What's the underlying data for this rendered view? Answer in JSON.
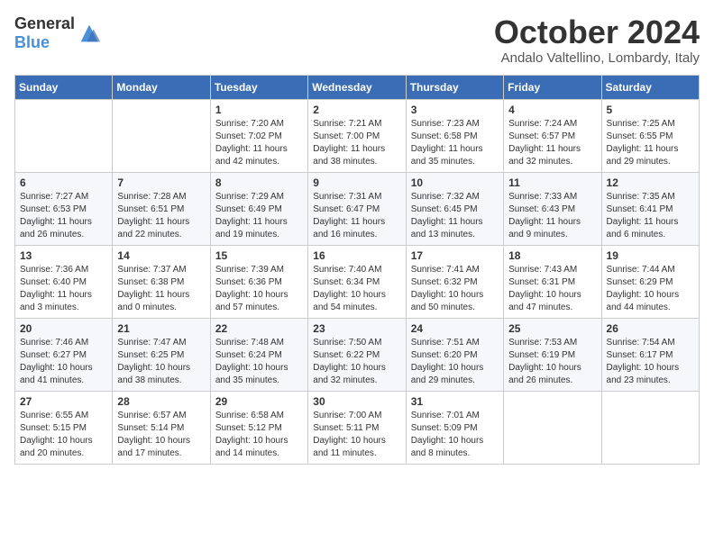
{
  "header": {
    "logo_general": "General",
    "logo_blue": "Blue",
    "month": "October 2024",
    "location": "Andalo Valtellino, Lombardy, Italy"
  },
  "weekdays": [
    "Sunday",
    "Monday",
    "Tuesday",
    "Wednesday",
    "Thursday",
    "Friday",
    "Saturday"
  ],
  "weeks": [
    [
      {
        "day": "",
        "info": ""
      },
      {
        "day": "",
        "info": ""
      },
      {
        "day": "1",
        "info": "Sunrise: 7:20 AM\nSunset: 7:02 PM\nDaylight: 11 hours and 42 minutes."
      },
      {
        "day": "2",
        "info": "Sunrise: 7:21 AM\nSunset: 7:00 PM\nDaylight: 11 hours and 38 minutes."
      },
      {
        "day": "3",
        "info": "Sunrise: 7:23 AM\nSunset: 6:58 PM\nDaylight: 11 hours and 35 minutes."
      },
      {
        "day": "4",
        "info": "Sunrise: 7:24 AM\nSunset: 6:57 PM\nDaylight: 11 hours and 32 minutes."
      },
      {
        "day": "5",
        "info": "Sunrise: 7:25 AM\nSunset: 6:55 PM\nDaylight: 11 hours and 29 minutes."
      }
    ],
    [
      {
        "day": "6",
        "info": "Sunrise: 7:27 AM\nSunset: 6:53 PM\nDaylight: 11 hours and 26 minutes."
      },
      {
        "day": "7",
        "info": "Sunrise: 7:28 AM\nSunset: 6:51 PM\nDaylight: 11 hours and 22 minutes."
      },
      {
        "day": "8",
        "info": "Sunrise: 7:29 AM\nSunset: 6:49 PM\nDaylight: 11 hours and 19 minutes."
      },
      {
        "day": "9",
        "info": "Sunrise: 7:31 AM\nSunset: 6:47 PM\nDaylight: 11 hours and 16 minutes."
      },
      {
        "day": "10",
        "info": "Sunrise: 7:32 AM\nSunset: 6:45 PM\nDaylight: 11 hours and 13 minutes."
      },
      {
        "day": "11",
        "info": "Sunrise: 7:33 AM\nSunset: 6:43 PM\nDaylight: 11 hours and 9 minutes."
      },
      {
        "day": "12",
        "info": "Sunrise: 7:35 AM\nSunset: 6:41 PM\nDaylight: 11 hours and 6 minutes."
      }
    ],
    [
      {
        "day": "13",
        "info": "Sunrise: 7:36 AM\nSunset: 6:40 PM\nDaylight: 11 hours and 3 minutes."
      },
      {
        "day": "14",
        "info": "Sunrise: 7:37 AM\nSunset: 6:38 PM\nDaylight: 11 hours and 0 minutes."
      },
      {
        "day": "15",
        "info": "Sunrise: 7:39 AM\nSunset: 6:36 PM\nDaylight: 10 hours and 57 minutes."
      },
      {
        "day": "16",
        "info": "Sunrise: 7:40 AM\nSunset: 6:34 PM\nDaylight: 10 hours and 54 minutes."
      },
      {
        "day": "17",
        "info": "Sunrise: 7:41 AM\nSunset: 6:32 PM\nDaylight: 10 hours and 50 minutes."
      },
      {
        "day": "18",
        "info": "Sunrise: 7:43 AM\nSunset: 6:31 PM\nDaylight: 10 hours and 47 minutes."
      },
      {
        "day": "19",
        "info": "Sunrise: 7:44 AM\nSunset: 6:29 PM\nDaylight: 10 hours and 44 minutes."
      }
    ],
    [
      {
        "day": "20",
        "info": "Sunrise: 7:46 AM\nSunset: 6:27 PM\nDaylight: 10 hours and 41 minutes."
      },
      {
        "day": "21",
        "info": "Sunrise: 7:47 AM\nSunset: 6:25 PM\nDaylight: 10 hours and 38 minutes."
      },
      {
        "day": "22",
        "info": "Sunrise: 7:48 AM\nSunset: 6:24 PM\nDaylight: 10 hours and 35 minutes."
      },
      {
        "day": "23",
        "info": "Sunrise: 7:50 AM\nSunset: 6:22 PM\nDaylight: 10 hours and 32 minutes."
      },
      {
        "day": "24",
        "info": "Sunrise: 7:51 AM\nSunset: 6:20 PM\nDaylight: 10 hours and 29 minutes."
      },
      {
        "day": "25",
        "info": "Sunrise: 7:53 AM\nSunset: 6:19 PM\nDaylight: 10 hours and 26 minutes."
      },
      {
        "day": "26",
        "info": "Sunrise: 7:54 AM\nSunset: 6:17 PM\nDaylight: 10 hours and 23 minutes."
      }
    ],
    [
      {
        "day": "27",
        "info": "Sunrise: 6:55 AM\nSunset: 5:15 PM\nDaylight: 10 hours and 20 minutes."
      },
      {
        "day": "28",
        "info": "Sunrise: 6:57 AM\nSunset: 5:14 PM\nDaylight: 10 hours and 17 minutes."
      },
      {
        "day": "29",
        "info": "Sunrise: 6:58 AM\nSunset: 5:12 PM\nDaylight: 10 hours and 14 minutes."
      },
      {
        "day": "30",
        "info": "Sunrise: 7:00 AM\nSunset: 5:11 PM\nDaylight: 10 hours and 11 minutes."
      },
      {
        "day": "31",
        "info": "Sunrise: 7:01 AM\nSunset: 5:09 PM\nDaylight: 10 hours and 8 minutes."
      },
      {
        "day": "",
        "info": ""
      },
      {
        "day": "",
        "info": ""
      }
    ]
  ]
}
